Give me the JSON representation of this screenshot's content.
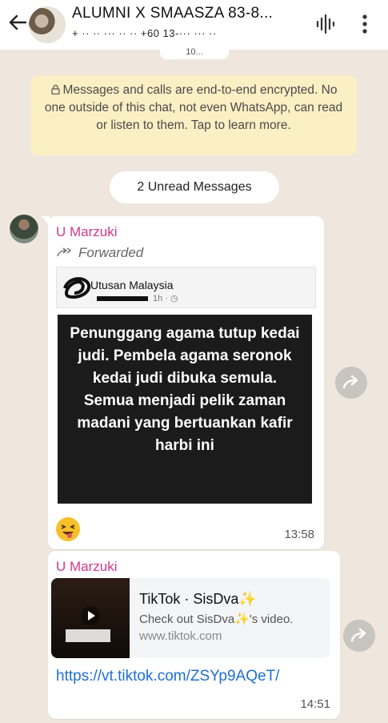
{
  "header": {
    "title": "ALUMNI X SMAASZA 83-8...",
    "subtitle": "+ ·· ·· ··· ·· ··  +60 13-··· ··· ··"
  },
  "chat": {
    "date_chip": "10...",
    "encryption_notice": "Messages and calls are end-to-end encrypted. No one outside of this chat, not even WhatsApp, can read or listen to them. Tap to learn more.",
    "unread_label": "2 Unread Messages",
    "messages": [
      {
        "sender": "U Marzuki",
        "forwarded_label": "Forwarded",
        "post": {
          "source": "Utusan Malaysia",
          "time": "1h",
          "image_text": "Penunggang agama tutup kedai judi. Pembela agama seronok kedai judi dibuka semula. Semua menjadi pelik zaman madani yang bertuankan kafir harbi ini"
        },
        "emoji": "zany-face",
        "time": "13:58"
      },
      {
        "sender": "U Marzuki",
        "link_preview": {
          "title": "TikTok · SisDva✨",
          "description": "Check out SisDva✨'s video.",
          "url": "www.tiktok.com"
        },
        "link": "https://vt.tiktok.com/ZSYp9AQeT/",
        "time": "14:51"
      }
    ]
  },
  "colors": {
    "header_bg": "#ffffff",
    "chat_bg": "#efe7de",
    "encryption_bg": "#fbefc4",
    "sender_name": "#d0398a",
    "link": "#1f6fd1"
  }
}
